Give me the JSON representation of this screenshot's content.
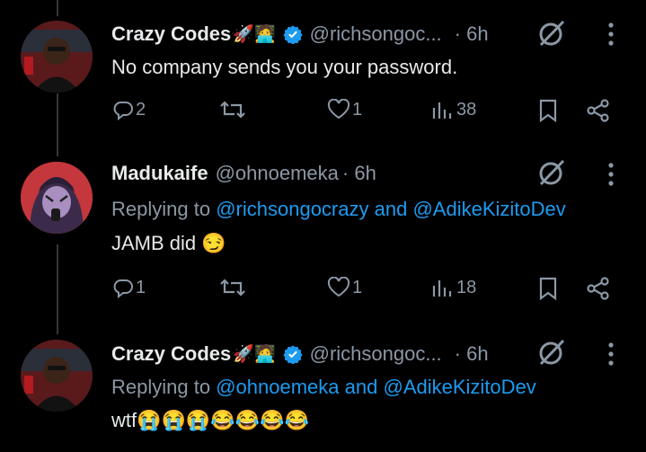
{
  "tweets": [
    {
      "name": "Crazy Codes",
      "name_emoji": "🚀🧑‍💻",
      "verified": true,
      "handle": "@richsongoc...",
      "time": "· 6h",
      "reply_prefix": "",
      "text": "No company sends you your password.",
      "replies": "2",
      "retweets": "",
      "likes": "1",
      "views": "38"
    },
    {
      "name": "Madukaife",
      "name_emoji": "",
      "verified": false,
      "handle": "@ohnoemeka",
      "time": "· 6h",
      "reply_prefix": "Replying to",
      "reply_mentions": "@richsongocrazy",
      "reply_and": "and",
      "reply_mentions2": "@AdikeKizitoDev",
      "text": "JAMB did 😏",
      "replies": "1",
      "retweets": "",
      "likes": "1",
      "views": "18"
    },
    {
      "name": "Crazy Codes",
      "name_emoji": "🚀🧑‍💻",
      "verified": true,
      "handle": "@richsongoc...",
      "time": "· 6h",
      "reply_prefix": "Replying to",
      "reply_mentions": "@ohnoemeka",
      "reply_and": "and",
      "reply_mentions2": "@AdikeKizitoDev",
      "text": "wtf😭😭😭😂😂😂😂",
      "replies": "",
      "retweets": "",
      "likes": "",
      "views": ""
    }
  ],
  "colors": {
    "bg": "#000000",
    "text": "#e7e9ea",
    "muted": "#8b98a5",
    "link": "#1d9bf0",
    "verified": "#1d9bf0"
  },
  "icons": [
    "reply-icon",
    "retweet-icon",
    "like-icon",
    "views-icon",
    "bookmark-icon",
    "share-icon",
    "grok-icon",
    "more-icon",
    "verified-icon"
  ]
}
